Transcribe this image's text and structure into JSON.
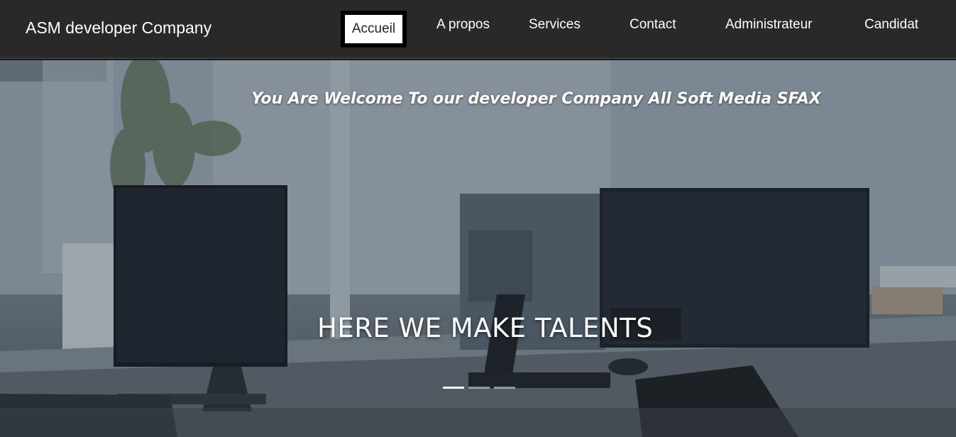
{
  "navbar": {
    "brand": "ASM developer Company",
    "items": [
      {
        "label": "Accueil",
        "active": true
      },
      {
        "label": "A propos"
      },
      {
        "label": "Services"
      },
      {
        "label": "Contact"
      },
      {
        "label": "Administrateur"
      },
      {
        "label": "Candidat"
      }
    ]
  },
  "hero": {
    "welcome": "You Are Welcome To our developer Company All Soft Media SFAX",
    "title": "HERE WE MAKE TALENTS",
    "slides": 3,
    "active_slide": 1
  }
}
